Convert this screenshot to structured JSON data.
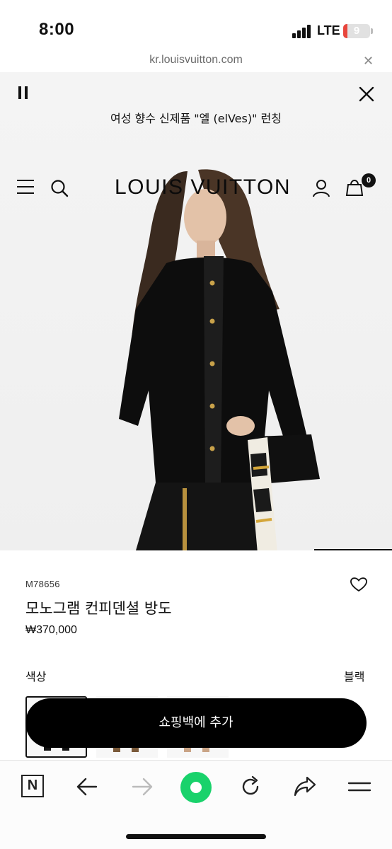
{
  "status_bar": {
    "time": "8:00",
    "network": "LTE",
    "battery": "9"
  },
  "browser": {
    "url": "kr.louisvuitton.com",
    "close_icon": "close-icon"
  },
  "banner": {
    "announcement": "여성 향수 신제품 \"엘 (elVes)\" 런칭"
  },
  "header": {
    "logo": "LOUIS VUITTON",
    "bag_count": "0"
  },
  "product": {
    "sku": "M78656",
    "name": "모노그램 컨피덴셜 방도",
    "price": "₩370,000",
    "color_label": "색상",
    "color_value": "블랙",
    "add_to_bag": "쇼핑백에 추가"
  },
  "icons": {
    "pause": "pause-icon",
    "close": "close-icon",
    "menu": "menu-icon",
    "search": "search-icon",
    "account": "user-icon",
    "bag": "shopping-bag-icon",
    "wishlist": "heart-icon",
    "naver": "naver-n-icon",
    "back": "arrow-left-icon",
    "forward": "arrow-right-icon",
    "home": "home-circle-icon",
    "reload": "reload-icon",
    "share": "share-icon",
    "browser_menu": "hamburger-icon"
  },
  "colors": {
    "brand_black": "#000000",
    "home_green": "#19d26b",
    "battery_red": "#e8453c"
  }
}
